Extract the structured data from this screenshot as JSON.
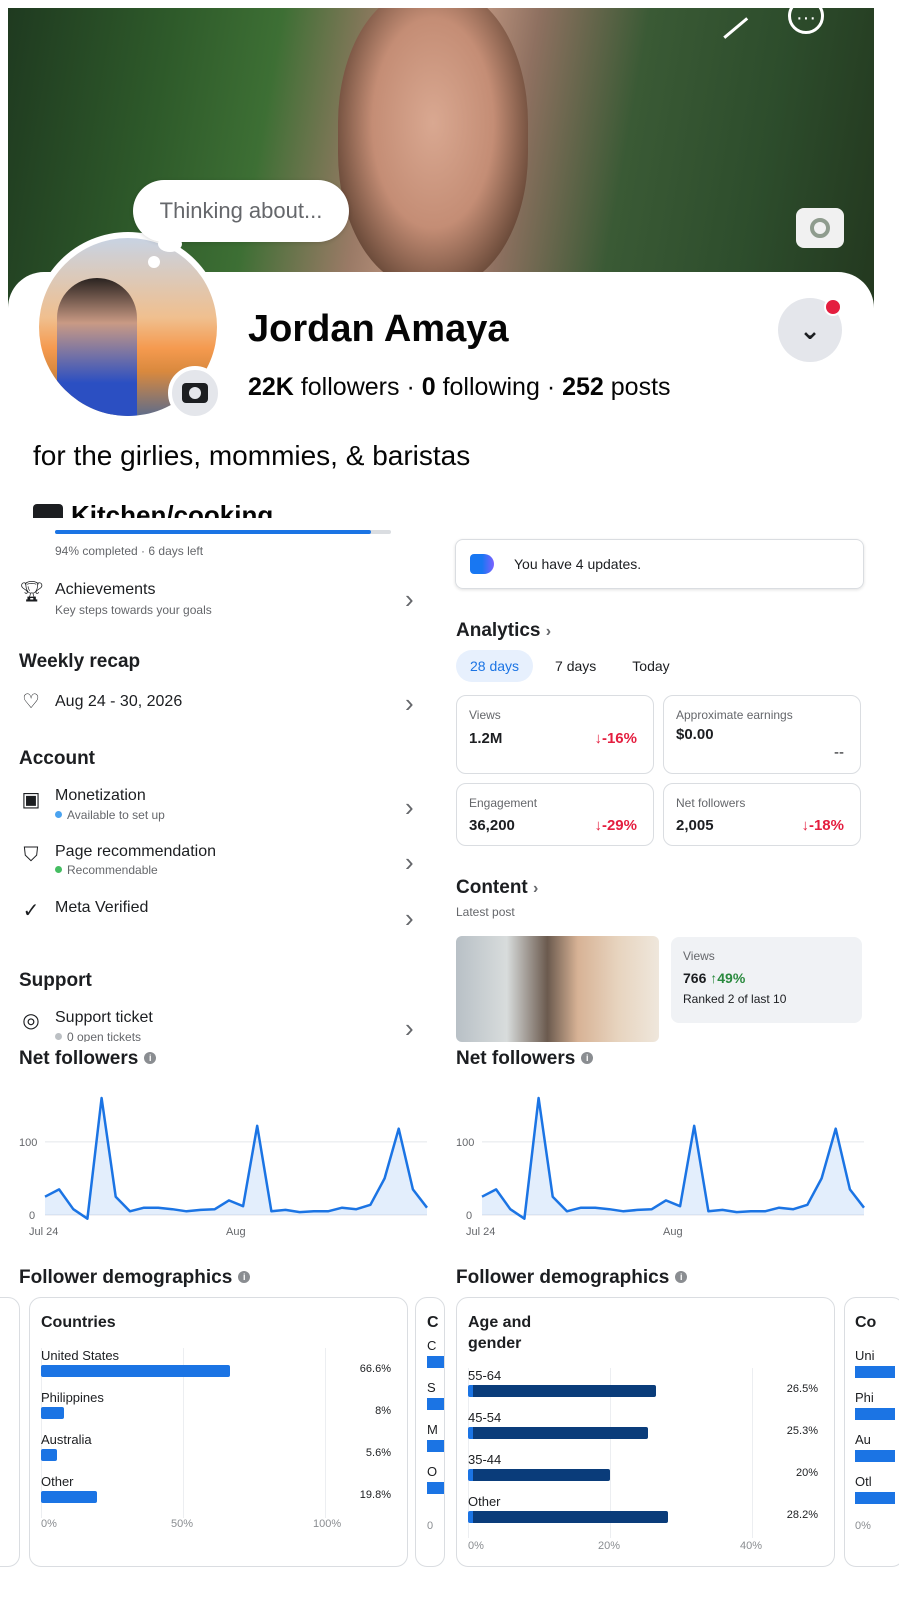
{
  "profile": {
    "thought_bubble": "Thinking about...",
    "name": "Jordan Amaya",
    "followers_count": "22K",
    "followers_label": "followers",
    "following_count": "0",
    "following_label": "following",
    "posts_count": "252",
    "posts_label": "posts",
    "bio": "for the girlies, mommies, & baristas",
    "category": "Kitchen/cooking"
  },
  "progress": {
    "text": "94% completed · 6 days left",
    "value_percent": 94
  },
  "left": {
    "achievements": {
      "title": "Achievements",
      "subtitle": "Key steps towards your goals"
    },
    "weekly_recap": {
      "heading": "Weekly recap",
      "range": "Aug 24 - 30, 2026"
    },
    "account": {
      "heading": "Account",
      "items": [
        {
          "title": "Monetization",
          "subtitle": "Available to set up",
          "dot_color": "#45bd62"
        },
        {
          "title": "Page recommendation",
          "subtitle": "Recommendable",
          "dot_color": "#45bd62"
        },
        {
          "title": "Meta Verified"
        }
      ]
    },
    "support": {
      "heading": "Support",
      "title": "Support ticket",
      "subtitle": "0 open tickets",
      "dot_color": "#bcc0c4"
    }
  },
  "right": {
    "updates_text": "You have 4 updates.",
    "analytics_heading": "Analytics",
    "tabs": [
      "28 days",
      "7 days",
      "Today"
    ],
    "active_tab": "28 days",
    "metrics": [
      {
        "label": "Views",
        "value": "1.2M",
        "delta": "↓-16%"
      },
      {
        "label": "Approximate earnings",
        "value": "$0.00",
        "delta": "--"
      },
      {
        "label": "Engagement",
        "value": "36,200",
        "delta": "↓-29%"
      },
      {
        "label": "Net followers",
        "value": "2,005",
        "delta": "↓-18%"
      }
    ],
    "content_heading": "Content",
    "content_sub": "Latest post",
    "post": {
      "label": "Views",
      "value": "766",
      "delta": "↑49%",
      "rank": "Ranked 2 of last 10"
    }
  },
  "net_followers_left": {
    "title": "Net followers"
  },
  "net_followers_right": {
    "title": "Net followers"
  },
  "demographics_left": {
    "title": "Follower demographics"
  },
  "demographics_right": {
    "title": "Follower demographics"
  },
  "chart_data": [
    {
      "type": "area",
      "title": "Net followers",
      "x_tick_labels": [
        "Jul 24",
        "Aug"
      ],
      "y_tick_labels": [
        "100",
        "0"
      ],
      "ylim": [
        0,
        160
      ],
      "values": [
        25,
        35,
        8,
        -5,
        160,
        25,
        5,
        10,
        10,
        8,
        5,
        7,
        8,
        20,
        12,
        122,
        5,
        7,
        4,
        5,
        5,
        10,
        8,
        14,
        50,
        118,
        35,
        10
      ],
      "color": "#1b74e4"
    },
    {
      "type": "area",
      "title": "Net followers",
      "x_tick_labels": [
        "Jul 24",
        "Aug"
      ],
      "y_tick_labels": [
        "100",
        "0"
      ],
      "ylim": [
        0,
        160
      ],
      "values": [
        25,
        35,
        8,
        -5,
        160,
        25,
        5,
        10,
        10,
        8,
        5,
        7,
        8,
        20,
        12,
        122,
        5,
        7,
        4,
        5,
        5,
        10,
        8,
        14,
        50,
        118,
        35,
        10
      ],
      "color": "#1b74e4"
    },
    {
      "type": "bar",
      "title": "Countries",
      "categories": [
        "United States",
        "Philippines",
        "Australia",
        "Other"
      ],
      "values": [
        66.6,
        8,
        5.6,
        19.8
      ],
      "value_labels": [
        "66.6%",
        "8%",
        "5.6%",
        "19.8%"
      ],
      "x_tick_labels": [
        "0%",
        "50%",
        "100%"
      ],
      "xlim": [
        0,
        100
      ],
      "color": "#1b74e4"
    },
    {
      "type": "bar",
      "title": "Age and gender",
      "categories": [
        "55-64",
        "45-54",
        "35-44",
        "Other"
      ],
      "values": [
        26.5,
        25.3,
        20,
        28.2
      ],
      "value_labels": [
        "26.5%",
        "25.3%",
        "20%",
        "28.2%"
      ],
      "x_tick_labels": [
        "0%",
        "20%",
        "40%"
      ],
      "xlim": [
        0,
        40
      ],
      "color": "#0a3c7a",
      "accent_color": "#1b74e4"
    }
  ],
  "peek_left": {
    "letters": [
      "C",
      "C",
      "S",
      "M",
      "O",
      "0"
    ]
  },
  "peek_right": {
    "labels": [
      "Co",
      "Uni",
      "Phi",
      "Au",
      "Otl",
      "0%"
    ]
  }
}
